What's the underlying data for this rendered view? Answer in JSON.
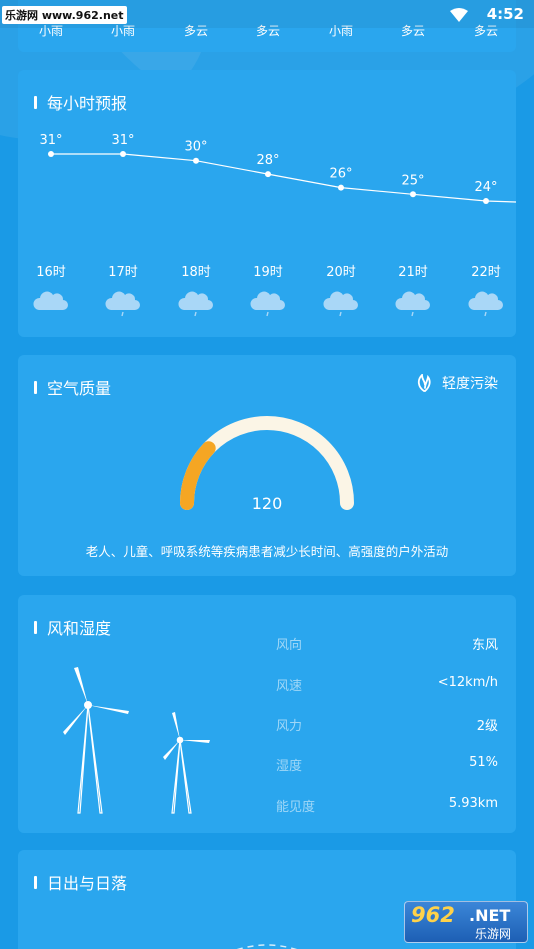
{
  "status": {
    "watermark_left_brand": "乐游网",
    "watermark_left_url": "www.962.net",
    "time": "4:52"
  },
  "top_strip": {
    "labels": [
      "小雨",
      "小雨",
      "多云",
      "多云",
      "小雨",
      "多云",
      "多云"
    ]
  },
  "hourly": {
    "title": "每小时预报",
    "hours": [
      {
        "temp": "31°",
        "time": "16时",
        "icon": "cloud-icon"
      },
      {
        "temp": "31°",
        "time": "17时",
        "icon": "cloud-rain-icon"
      },
      {
        "temp": "30°",
        "time": "18时",
        "icon": "cloud-rain-icon"
      },
      {
        "temp": "28°",
        "time": "19时",
        "icon": "cloud-rain-icon"
      },
      {
        "temp": "26°",
        "time": "20时",
        "icon": "cloud-rain-icon"
      },
      {
        "temp": "25°",
        "time": "21时",
        "icon": "cloud-rain-icon"
      },
      {
        "temp": "24°",
        "time": "22时",
        "icon": "cloud-rain-icon"
      }
    ],
    "temps": [
      31,
      31,
      30,
      28,
      26,
      25,
      24
    ]
  },
  "air": {
    "title": "空气质量",
    "status": "轻度污染",
    "value": "120",
    "gauge_fraction": 0.24,
    "advice": "老人、儿童、呼吸系统等疾病患者减少长时间、高强度的户外活动",
    "colors": {
      "fill": "#f5a623",
      "track": "#fbf5e6"
    }
  },
  "wind": {
    "title": "风和湿度",
    "rows": [
      {
        "label": "风向",
        "value": "东风"
      },
      {
        "label": "风速",
        "value": "<12km/h"
      },
      {
        "label": "风力",
        "value": "2级"
      },
      {
        "label": "湿度",
        "value": "51%"
      },
      {
        "label": "能见度",
        "value": "5.93km"
      }
    ]
  },
  "sun": {
    "title": "日出与日落"
  },
  "watermark": {
    "big": "962",
    "net": ".NET",
    "small": "乐游网"
  }
}
